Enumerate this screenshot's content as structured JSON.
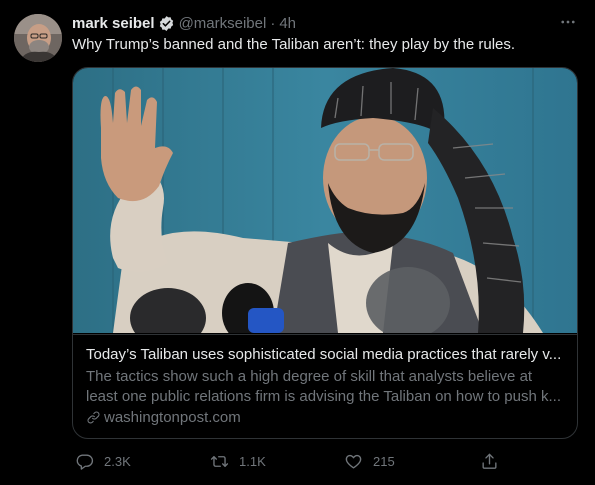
{
  "tweet": {
    "author_name": "mark seibel",
    "handle": "@markseibel",
    "separator": "·",
    "time": "4h",
    "text": "Why Trump’s banned and the Taliban aren’t: they play by the rules."
  },
  "card": {
    "title": "Today’s Taliban uses sophisticated social media practices that rarely v...",
    "description_lines": [
      "The tactics show such a high degree of skill that analysts believe at",
      "least one public relations firm is advising the Taliban on how to push k..."
    ],
    "domain": "washingtonpost.com"
  },
  "actions": {
    "reply_count": "2.3K",
    "retweet_count": "1.1K",
    "like_count": "215"
  },
  "icons": {
    "verified": "verified-badge-icon",
    "more": "more-options-icon",
    "link": "link-icon",
    "reply": "reply-icon",
    "retweet": "retweet-icon",
    "like": "heart-icon",
    "share": "share-icon"
  },
  "colors": {
    "background": "#000000",
    "text_primary": "#e7e9ea",
    "text_secondary": "#71767b",
    "border": "#2f3336"
  }
}
